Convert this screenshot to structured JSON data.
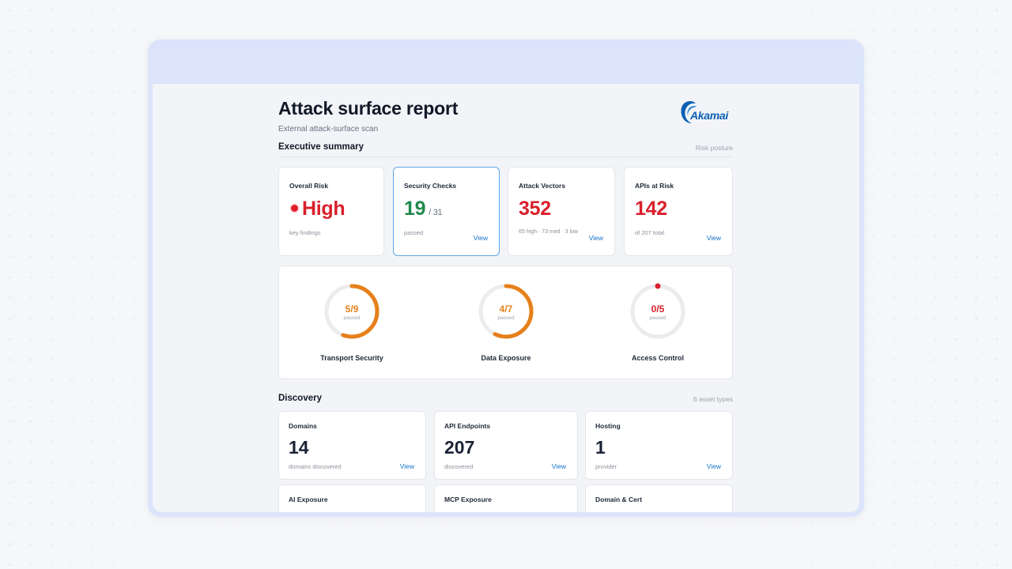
{
  "report": {
    "title": "Attack surface report",
    "subtitle": "External attack-surface scan",
    "logo_text": "Akamai"
  },
  "executive_summary": {
    "title": "Executive summary",
    "meta": "Risk posture",
    "cards": [
      {
        "label": "Overall Risk",
        "value": "High",
        "note": "key findings",
        "value_color": "#d9202c"
      },
      {
        "label": "Security Checks",
        "value": "19",
        "denominator": "/ 31",
        "note": "passed",
        "view": "View",
        "value_color": "#1f8a4c"
      },
      {
        "label": "Attack Vectors",
        "value": "352",
        "note": "65 high · 73 med · 3 low",
        "view": "View",
        "value_color": "#d9202c"
      },
      {
        "label": "APIs at Risk",
        "value": "142",
        "note": "of 207 total",
        "view": "View",
        "value_color": "#d9202c"
      }
    ]
  },
  "gauges": [
    {
      "label": "Transport Security",
      "value": "5/9",
      "sub": "passed",
      "passed": 5,
      "total": 9,
      "color": "#e6801a"
    },
    {
      "label": "Data Exposure",
      "value": "4/7",
      "sub": "passed",
      "passed": 4,
      "total": 7,
      "color": "#e6801a"
    },
    {
      "label": "Access Control",
      "value": "0/5",
      "sub": "passed",
      "passed": 0,
      "total": 5,
      "color": "#d9202c"
    }
  ],
  "discovery": {
    "title": "Discovery",
    "meta": "6 asset types",
    "cards": [
      {
        "label": "Domains",
        "value": "14",
        "note": "domains discovered",
        "view": "View"
      },
      {
        "label": "API Endpoints",
        "value": "207",
        "note": "discovered",
        "view": "View"
      },
      {
        "label": "Hosting",
        "value": "1",
        "note": "provider",
        "view": "View"
      },
      {
        "label": "AI Exposure"
      },
      {
        "label": "MCP Exposure"
      },
      {
        "label": "Domain & Cert"
      }
    ]
  },
  "colors": {
    "frame": "#dbe4fb",
    "accent_link": "#1673c9",
    "risk_red": "#d9202c",
    "pass_green": "#1f8a4c",
    "gauge_orange": "#e6801a"
  }
}
